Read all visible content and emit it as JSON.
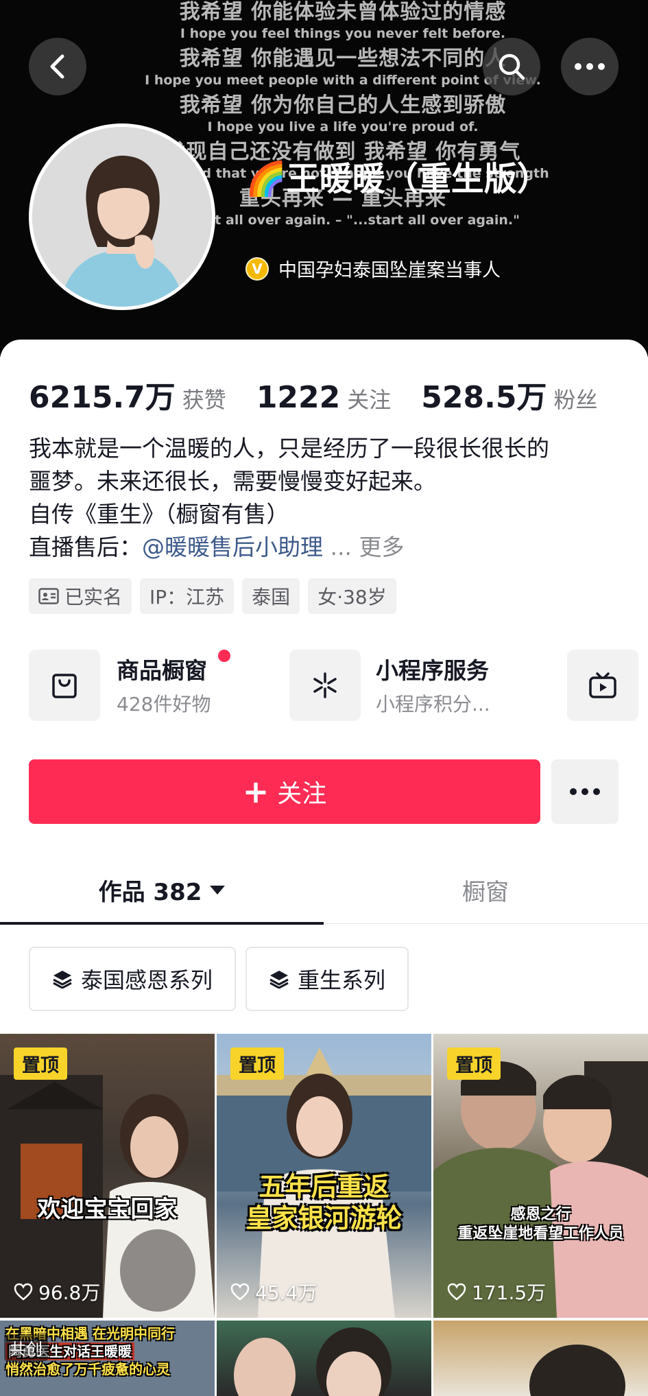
{
  "header": {
    "banner_lines": [
      {
        "cn": "我希望 你能体验未曾体验过的情感",
        "en": "I hope you feel things you never felt before."
      },
      {
        "cn": "我希望 你能遇见一些想法不同的人",
        "en": "I hope you meet people with a different point of view."
      },
      {
        "cn": "我希望 你为你自己的人生感到骄傲",
        "en": "I hope you live a life you're proud of."
      },
      {
        "cn": "发现自己还没有做到 我希望 你有勇气",
        "en": "If you find that you're not, I hope you have the strength"
      },
      {
        "cn": "重头再来 — 重头再来",
        "en": "to start all over again. – \"...start all over again.\""
      }
    ],
    "name": "🌈王暖暖（重生版）",
    "verified_text": "中国孕妇泰国坠崖案当事人",
    "verified_badge": "V"
  },
  "stats": [
    {
      "num": "6215.7万",
      "label": "获赞"
    },
    {
      "num": "1222",
      "label": "关注"
    },
    {
      "num": "528.5万",
      "label": "粉丝"
    }
  ],
  "bio": {
    "line1": "我本就是一个温暖的人，只是经历了一段很长很长的",
    "line2": "噩梦。未来还很长，需要慢慢变好起来。",
    "line3": "自传《重生》（橱窗有售）",
    "line4_prefix": "直播售后：",
    "line4_link": "@暖暖售后小助理",
    "line4_ellipsis": " ... ",
    "more": "更多"
  },
  "tags": [
    "已实名",
    "IP：江苏",
    "泰国",
    "女·38岁"
  ],
  "services": {
    "shop": {
      "title": "商品橱窗",
      "sub": "428件好物"
    },
    "mini": {
      "title": "小程序服务",
      "sub": "小程序积分..."
    }
  },
  "follow_label": "关注",
  "tabs": {
    "works": "作品 382",
    "showcase": "橱窗"
  },
  "collections": [
    "泰国感恩系列",
    "重生系列"
  ],
  "videos": [
    {
      "pin": "置顶",
      "caption": "欢迎宝宝回家",
      "likes": "96.8万"
    },
    {
      "pin": "置顶",
      "caption_line1": "五年后重返",
      "caption_line2": "皇家银河游轮",
      "likes": "45.4万"
    },
    {
      "pin": "置顶",
      "caption_line1": "感恩之行",
      "caption_line2": "重返坠崖地看望工作人员",
      "likes": "171.5万"
    }
  ],
  "row2": {
    "cell1_line1": "在黑暗中相遇 在光明中同行",
    "cell1_line2": "陶勇医生对话王暖暖",
    "cell1_line3": "悄然治愈了万千疲惫的心灵",
    "cell1_badge": "共创"
  },
  "colors": {
    "accent": "#fe2c55",
    "pin": "#f8d42a",
    "link": "#3d5a8a"
  }
}
